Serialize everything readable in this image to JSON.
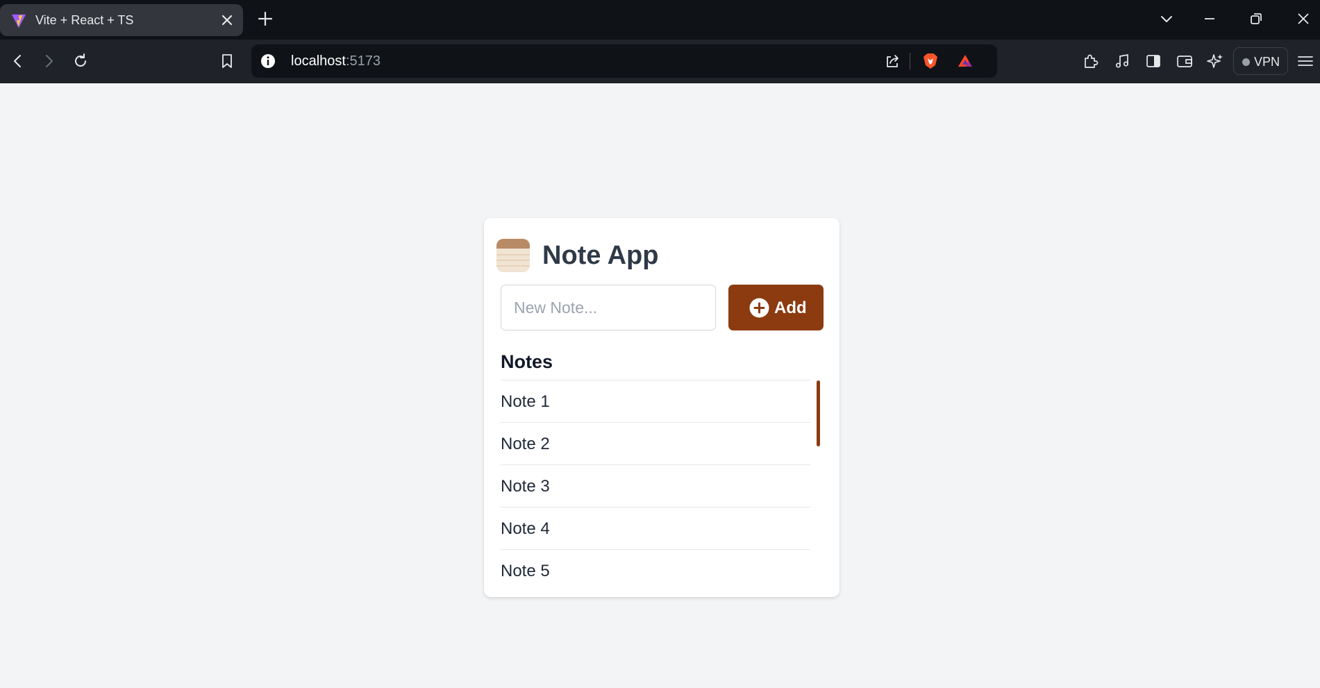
{
  "browser": {
    "tab": {
      "title": "Vite + React + TS"
    },
    "address": {
      "host": "localhost",
      "port": ":5173"
    },
    "vpn_label": "VPN"
  },
  "app": {
    "title": "Note App",
    "input": {
      "placeholder": "New Note...",
      "value": ""
    },
    "add_button": {
      "label": "Add"
    },
    "notes_heading": "Notes",
    "notes": [
      "Note 1",
      "Note 2",
      "Note 3",
      "Note 4",
      "Note 5"
    ]
  },
  "colors": {
    "accent": "#8b3b0f",
    "page_background": "#f3f4f6",
    "browser_frame": "#0f1318",
    "browser_toolbar": "#1f2329"
  },
  "icons": {
    "tab_favicon": "vite-icon",
    "app_icon": "notepad-icon",
    "add_button_icon": "plus-circle-icon"
  }
}
